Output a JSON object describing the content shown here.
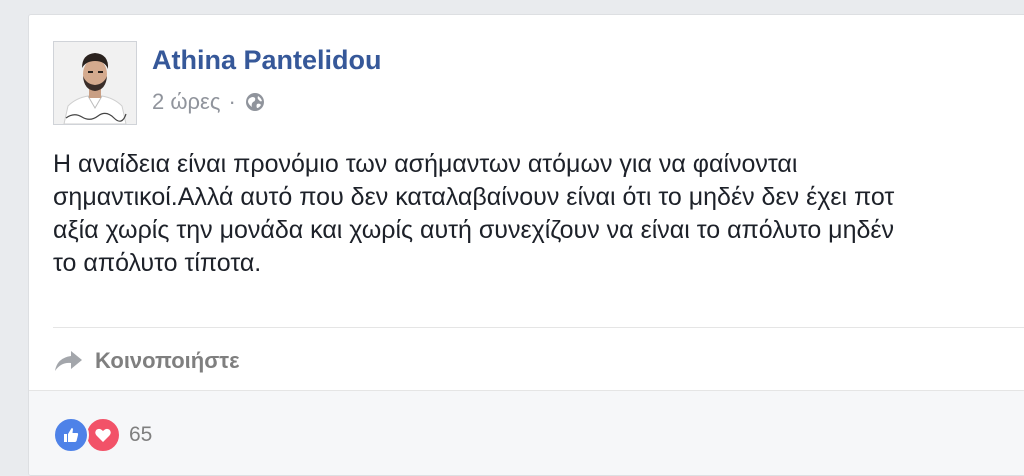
{
  "post": {
    "author": "Athina Pantelidou",
    "timestamp": "2 ώρες",
    "separator": "·",
    "privacy_icon": "globe-icon",
    "text_lines": [
      "Η αναίδεια είναι προνόμιο των ασήμαντων ατόμων για να φαίνονται",
      "σημαντικοί.Αλλά αυτό που δεν καταλαβαίνουν είναι ότι το μηδέν δεν έχει ποτ",
      "αξία χωρίς την μονάδα και χωρίς αυτή συνεχίζουν να είναι το απόλυτο μηδέν",
      "το απόλυτο τίποτα."
    ]
  },
  "actions": {
    "share_icon": "share-arrow-icon",
    "share_label": "Κοινοποιήστε"
  },
  "reactions": {
    "icons": [
      "like-icon",
      "love-icon"
    ],
    "count": "65"
  },
  "colors": {
    "author_link": "#365899",
    "meta_text": "#90949c",
    "body_text": "#1d2129",
    "like_blue": "#4e82e8",
    "love_red": "#f25268",
    "background": "#e9ebee"
  }
}
